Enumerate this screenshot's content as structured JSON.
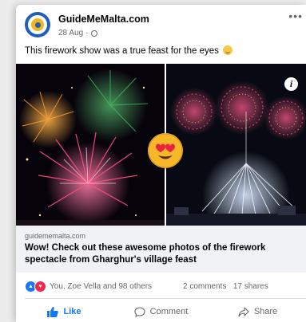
{
  "post": {
    "page_name": "GuideMeMalta.com",
    "date": "28 Aug",
    "text": "This firework show was a true feast for the eyes"
  },
  "link": {
    "domain": "guidememalta.com",
    "title": "Wow! Check out these awesome photos of the firework spectacle from Gharghur's village feast"
  },
  "reactions": {
    "summary": "You, Zoe Vella and 98 others",
    "comments": "2 comments",
    "shares": "17 shares"
  },
  "actions": {
    "like": "Like",
    "comment": "Comment",
    "share": "Share"
  },
  "icons": [
    "more-options-icon",
    "globe-icon",
    "info-icon",
    "heart-eyes-emoji",
    "like-reaction-icon",
    "love-reaction-icon",
    "thumbs-up-icon",
    "comment-icon",
    "share-icon"
  ],
  "colors": {
    "brand_blue": "#1877f2",
    "love_red": "#f02849",
    "avatar_blue": "#1f5fb8",
    "avatar_yellow": "#f3b51d"
  }
}
